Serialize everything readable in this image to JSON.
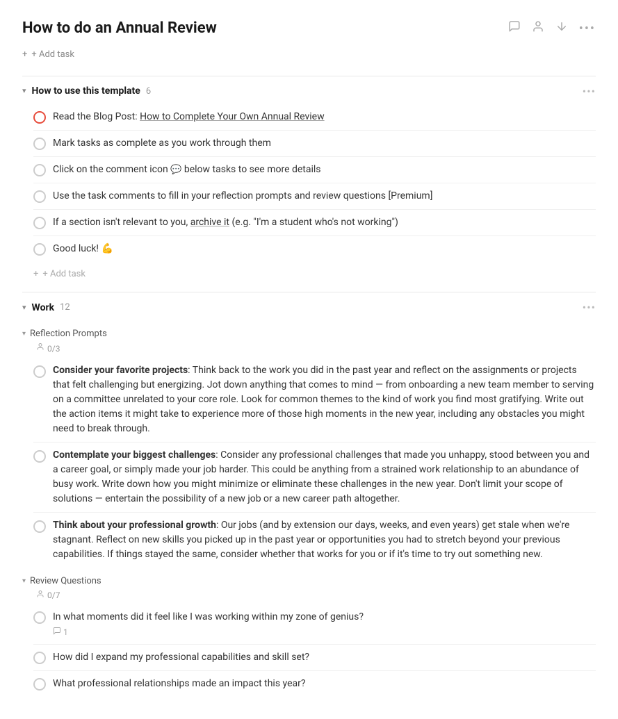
{
  "header": {
    "title": "How to do an Annual Review",
    "add_task_label": "+ Add task"
  },
  "icons": {
    "comment": "💬",
    "person": "👤",
    "sort": "↕",
    "more": "•••",
    "chevron_down": "▾",
    "plus": "+",
    "check_circle": "○"
  },
  "sections": [
    {
      "id": "how-to-use",
      "title": "How to use this template",
      "count": "6",
      "tasks": [
        {
          "id": "t1",
          "text_before_link": "Read the Blog Post: ",
          "link_text": "How to Complete Your Own Annual Review",
          "text_after_link": "",
          "is_red": true
        },
        {
          "id": "t2",
          "text": "Mark tasks as complete as you work through them"
        },
        {
          "id": "t3",
          "text_before_link": "Click on the comment icon ",
          "link_text": "",
          "text_middle": "💬",
          "text_after": " below tasks to see more details"
        },
        {
          "id": "t4",
          "text": "Use the task comments to fill in your reflection prompts and review questions [Premium]"
        },
        {
          "id": "t5",
          "text_before_link": "If a section isn't relevant to you, ",
          "link_text": "archive it",
          "text_after_link": " (e.g. \"I'm a student who's not working\")"
        },
        {
          "id": "t6",
          "text": "Good luck! 💪"
        }
      ],
      "add_task_label": "+ Add task"
    },
    {
      "id": "work",
      "title": "Work",
      "count": "12",
      "subsections": [
        {
          "id": "reflection-prompts",
          "title": "Reflection Prompts",
          "meta": "0/3",
          "tasks": [
            {
              "id": "rp1",
              "bold_text": "Consider your favorite projects",
              "text": ": Think back to the work you did in the past year and reflect on the assignments or projects that felt challenging but energizing. Jot down anything that comes to mind — from onboarding a new team member to serving on a committee unrelated to your core role. Look for common themes to the kind of work you find most gratifying. Write out the action items it might take to experience more of those high moments in the new year, including any obstacles you might need to break through."
            },
            {
              "id": "rp2",
              "bold_text": "Contemplate your biggest challenges",
              "text": ": Consider any professional challenges that made you unhappy, stood between you and a career goal, or simply made your job harder. This could be anything from a strained work relationship to an abundance of busy work. Write down how you might minimize or eliminate these challenges in the new year. Don't limit your scope of solutions — entertain the possibility of a new job or a new career path altogether."
            },
            {
              "id": "rp3",
              "bold_text": "Think about your professional growth",
              "text": ": Our jobs (and by extension our days, weeks, and even years) get stale when we're stagnant. Reflect on new skills you picked up in the past year or opportunities you had to stretch beyond your previous capabilities. If things stayed the same, consider whether that works for you or if it's time to try out something new."
            }
          ]
        },
        {
          "id": "review-questions",
          "title": "Review Questions",
          "meta": "0/7",
          "tasks": [
            {
              "id": "rq1",
              "text": "In what moments did it feel like I was working within my zone of genius?",
              "comment_count": "1"
            },
            {
              "id": "rq2",
              "text": "How did I expand my professional capabilities and skill set?"
            },
            {
              "id": "rq3",
              "text": "What professional relationships made an impact this year?"
            }
          ]
        }
      ]
    }
  ]
}
